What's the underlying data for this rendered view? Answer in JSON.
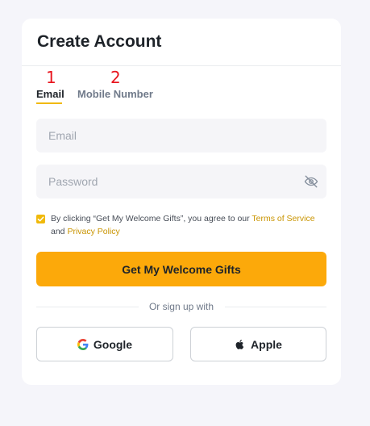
{
  "page": {
    "title": "Create Account"
  },
  "tabs": [
    {
      "number": "1",
      "label": "Email",
      "active": true
    },
    {
      "number": "2",
      "label": "Mobile Number",
      "active": false
    }
  ],
  "form": {
    "email_placeholder": "Email",
    "email_value": "",
    "password_placeholder": "Password",
    "password_value": "",
    "agree_checked": true,
    "terms_prefix": "By clicking “Get My Welcome Gifts”, you agree to our ",
    "terms_link": "Terms of Service",
    "terms_middle": " and ",
    "privacy_link": "Privacy Policy",
    "submit_label": "Get My Welcome Gifts"
  },
  "social": {
    "divider_text": "Or sign up with",
    "google_label": "Google",
    "apple_label": "Apple",
    "google_icon": "google-icon",
    "apple_icon": "apple-icon"
  },
  "colors": {
    "accent": "#fca90a",
    "link": "#c99400",
    "tab_numbers": "#e8161f"
  }
}
